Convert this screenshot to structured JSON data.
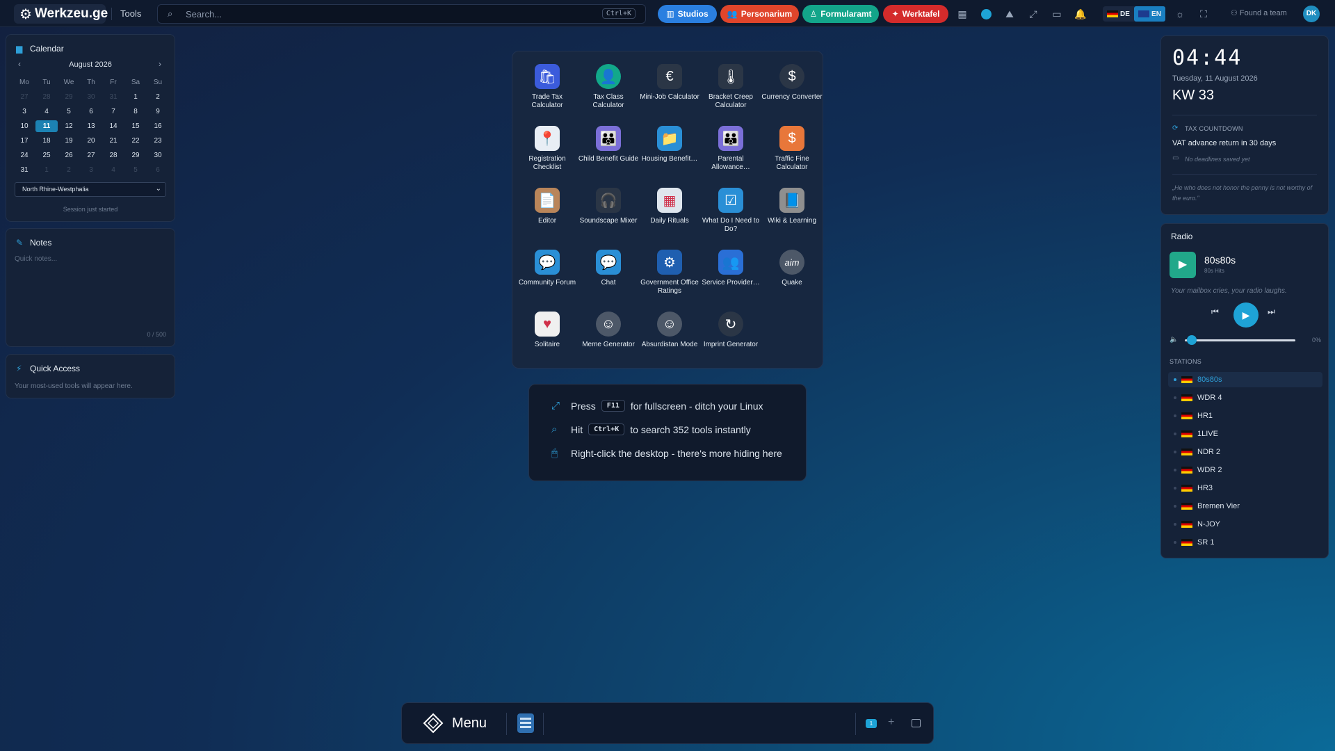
{
  "topbar": {
    "logo_text": "Werkzeu.ge",
    "tools_label": "Tools",
    "search_placeholder": "Search...",
    "search_shortcut": "Ctrl+K",
    "pills": [
      {
        "label": "Studios",
        "color": "#2a7fe0"
      },
      {
        "label": "Personarium",
        "color": "#e0452b"
      },
      {
        "label": "Formularamt",
        "color": "#13a58a"
      },
      {
        "label": "Werktafel",
        "color": "#d42b2b"
      }
    ],
    "lang_de": "DE",
    "lang_en": "EN",
    "find_team": "Found a team",
    "avatar_initials": "DK"
  },
  "calendar": {
    "title": "Calendar",
    "month_label": "August 2026",
    "weekdays": [
      "Mo",
      "Tu",
      "We",
      "Th",
      "Fr",
      "Sa",
      "Su"
    ],
    "days": [
      {
        "d": "27",
        "dim": true
      },
      {
        "d": "28",
        "dim": true
      },
      {
        "d": "29",
        "dim": true
      },
      {
        "d": "30",
        "dim": true
      },
      {
        "d": "31",
        "dim": true
      },
      {
        "d": "1"
      },
      {
        "d": "2"
      },
      {
        "d": "3"
      },
      {
        "d": "4"
      },
      {
        "d": "5"
      },
      {
        "d": "6"
      },
      {
        "d": "7"
      },
      {
        "d": "8"
      },
      {
        "d": "9"
      },
      {
        "d": "10"
      },
      {
        "d": "11",
        "today": true
      },
      {
        "d": "12"
      },
      {
        "d": "13"
      },
      {
        "d": "14"
      },
      {
        "d": "15"
      },
      {
        "d": "16"
      },
      {
        "d": "17"
      },
      {
        "d": "18"
      },
      {
        "d": "19"
      },
      {
        "d": "20"
      },
      {
        "d": "21"
      },
      {
        "d": "22"
      },
      {
        "d": "23"
      },
      {
        "d": "24"
      },
      {
        "d": "25"
      },
      {
        "d": "26"
      },
      {
        "d": "27"
      },
      {
        "d": "28"
      },
      {
        "d": "29"
      },
      {
        "d": "30"
      },
      {
        "d": "31"
      },
      {
        "d": "1",
        "dim": true
      },
      {
        "d": "2",
        "dim": true
      },
      {
        "d": "3",
        "dim": true
      },
      {
        "d": "4",
        "dim": true
      },
      {
        "d": "5",
        "dim": true
      },
      {
        "d": "6",
        "dim": true
      }
    ],
    "region": "North Rhine-Westphalia",
    "session_text": "Session just started"
  },
  "notes": {
    "title": "Notes",
    "placeholder": "Quick notes...",
    "counter": "0 / 500"
  },
  "quick_access": {
    "title": "Quick Access",
    "text": "Your most-used tools will appear here."
  },
  "apps": [
    {
      "label": "Trade Tax Calculator",
      "icon": "shopping-bag-icon",
      "glyph": "🛍",
      "bg": "#3b5bdb"
    },
    {
      "label": "Tax Class Calculator",
      "icon": "person-icon",
      "glyph": "👤",
      "bg": "#12a88a"
    },
    {
      "label": "Mini-Job Calculator",
      "icon": "euro-icon",
      "glyph": "€",
      "bg": "#2b3646"
    },
    {
      "label": "Bracket Creep Calculator",
      "icon": "thermometer-icon",
      "glyph": "🌡",
      "bg": "#2b3646"
    },
    {
      "label": "Currency Converter",
      "icon": "dollar-icon",
      "glyph": "$",
      "bg": "#2b3646"
    },
    {
      "label": "Registration Checklist",
      "icon": "map-pin-icon",
      "glyph": "📍",
      "bg": "#e8eef5"
    },
    {
      "label": "Child Benefit Guide",
      "icon": "family-icon",
      "glyph": "👪",
      "bg": "#7b6fd8"
    },
    {
      "label": "Housing Benefit…",
      "icon": "folder-icon",
      "glyph": "📁",
      "bg": "#2a8fd6"
    },
    {
      "label": "Parental Allowance…",
      "icon": "family-icon",
      "glyph": "👪",
      "bg": "#7b6fd8"
    },
    {
      "label": "Traffic Fine Calculator",
      "icon": "fine-diamond-icon",
      "glyph": "$",
      "bg": "#e8773a"
    },
    {
      "label": "Editor",
      "icon": "document-icon",
      "glyph": "📄",
      "bg": "#b9855a"
    },
    {
      "label": "Soundscape Mixer",
      "icon": "headphones-icon",
      "glyph": "🎧",
      "bg": "#2b3646"
    },
    {
      "label": "Daily Rituals",
      "icon": "calendar-grid-icon",
      "glyph": "▦",
      "bg": "#dfe6ee"
    },
    {
      "label": "What Do I Need to Do?",
      "icon": "checklist-icon",
      "glyph": "☑",
      "bg": "#2a8fd6"
    },
    {
      "label": "Wiki & Learning",
      "icon": "book-icon",
      "glyph": "📘",
      "bg": "#8f8f8f"
    },
    {
      "label": "Community Forum",
      "icon": "chat-bubbles-icon",
      "glyph": "💬",
      "bg": "#2a8fd6"
    },
    {
      "label": "Chat",
      "icon": "chat-bubbles-icon",
      "glyph": "💬",
      "bg": "#2a8fd6"
    },
    {
      "label": "Government Office Ratings",
      "icon": "settings-gear-icon",
      "glyph": "⚙",
      "bg": "#1f5fb0"
    },
    {
      "label": "Service Provider…",
      "icon": "contacts-icon",
      "glyph": "👥",
      "bg": "#2a6fd6"
    },
    {
      "label": "Quake",
      "icon": "aim-icon",
      "glyph": "aim",
      "bg": "#4d5868"
    },
    {
      "label": "Solitaire",
      "icon": "playing-card-icon",
      "glyph": "♥",
      "bg": "#f0f0f0"
    },
    {
      "label": "Meme Generator",
      "icon": "smiley-icon",
      "glyph": "☺",
      "bg": "#4d5868"
    },
    {
      "label": "Absurdistan Mode",
      "icon": "smiley-icon",
      "glyph": "☺",
      "bg": "#4d5868"
    },
    {
      "label": "Imprint Generator",
      "icon": "refresh-icon",
      "glyph": "↻",
      "bg": "#2b3646"
    }
  ],
  "hints": [
    {
      "pre": "Press",
      "key": "F11",
      "post": "for fullscreen - ditch your Linux",
      "icon": "expand-icon",
      "glyph": "⤢"
    },
    {
      "pre": "Hit",
      "key": "Ctrl+K",
      "post": "to search 352 tools instantly",
      "icon": "search-icon",
      "glyph": "⌕"
    },
    {
      "pre": "",
      "key": "",
      "post": "Right-click the desktop - there's more hiding here",
      "icon": "mouse-icon",
      "glyph": "🖱"
    }
  ],
  "clock": {
    "time": "04:44",
    "date": "Tuesday, 11 August 2026",
    "week": "KW 33",
    "tax_countdown_label": "TAX COUNTDOWN",
    "tax_countdown_text": "VAT advance return in 30 days",
    "no_deadlines": "No deadlines saved yet",
    "quote": "„He who does not honor the penny is not worthy of the euro.\""
  },
  "radio": {
    "title": "Radio",
    "station_name": "80s80s",
    "station_sub": "80s Hits",
    "tagline": "Your mailbox cries, your radio laughs.",
    "volume_pct_label": "0%",
    "volume_level": 0,
    "stations_label": "STATIONS",
    "stations": [
      {
        "name": "80s80s",
        "active": true
      },
      {
        "name": "WDR 4"
      },
      {
        "name": "HR1"
      },
      {
        "name": "1LIVE"
      },
      {
        "name": "NDR 2"
      },
      {
        "name": "WDR 2"
      },
      {
        "name": "HR3"
      },
      {
        "name": "Bremen Vier"
      },
      {
        "name": "N-JOY"
      },
      {
        "name": "SR 1"
      }
    ]
  },
  "taskbar": {
    "menu_label": "Menu",
    "workspace_number": "1"
  }
}
